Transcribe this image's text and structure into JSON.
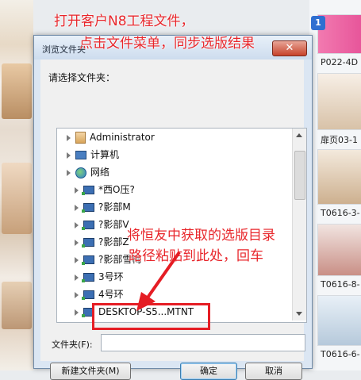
{
  "annotations": {
    "top_line1": "打开客户N8工程文件，",
    "top_line2": "点击文件菜单，同步选版结果",
    "middle_line1": "将恒友中获取的选版目录",
    "middle_line2": "路径粘贴到此处，回车"
  },
  "dialog": {
    "title": "浏览文件夹",
    "close_glyph": "✕",
    "prompt": "请选择文件夹：",
    "tree": [
      {
        "label": "Administrator",
        "icon": "user-folder-icon"
      },
      {
        "label": "计算机",
        "icon": "computer-icon"
      },
      {
        "label": "网络",
        "icon": "network-globe-icon"
      },
      {
        "label": "*西O压?",
        "icon": "network-computer-icon"
      },
      {
        "label": "?影部M",
        "icon": "network-computer-icon"
      },
      {
        "label": "?影部V",
        "icon": "network-computer-icon"
      },
      {
        "label": "?影部Z",
        "icon": "network-computer-icon"
      },
      {
        "label": "?影部雪梅",
        "icon": "network-computer-icon"
      },
      {
        "label": "3号环",
        "icon": "network-computer-icon"
      },
      {
        "label": "4号环",
        "icon": "network-computer-icon"
      },
      {
        "label": "DESKTOP-S5...MTNT",
        "icon": "network-computer-icon"
      }
    ],
    "folder_label": "文件夹(F):",
    "folder_value": "",
    "new_folder_button": "新建文件夹(M)",
    "ok_button": "确定",
    "cancel_button": "取消"
  },
  "background": {
    "badge": "1",
    "thumb_labels": [
      "P022-4D",
      "扉页03-1",
      "T0616-3-",
      "T0616-8-",
      "T0616-6-"
    ]
  },
  "colors": {
    "annotation_red": "#e8262b",
    "dialog_frame": "#dbe6f3",
    "close_red": "#c7432b"
  }
}
